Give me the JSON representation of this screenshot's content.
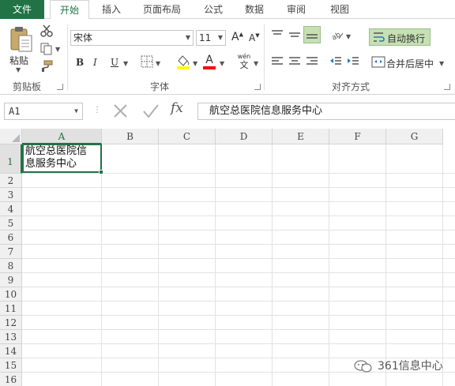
{
  "tabs": {
    "file": "文件",
    "home": "开始",
    "insert": "插入",
    "page_layout": "页面布局",
    "formulas": "公式",
    "data": "数据",
    "review": "审阅",
    "view": "视图"
  },
  "ribbon": {
    "clipboard": {
      "paste_label": "粘贴",
      "group_label": "剪贴板"
    },
    "font": {
      "font_name": "宋体",
      "font_size": "11",
      "bold": "B",
      "italic": "I",
      "underline": "U",
      "font_color_glyph": "A",
      "grow_font": "A",
      "shrink_font": "A",
      "phonetic_top": "wén",
      "phonetic_bottom": "文",
      "group_label": "字体"
    },
    "alignment": {
      "wrap_text": "自动换行",
      "merge_center": "合并后居中",
      "group_label": "对齐方式"
    }
  },
  "formula_bar": {
    "name_box": "A1",
    "fx": "fx",
    "content": "航空总医院信息服务中心"
  },
  "grid": {
    "columns": [
      "A",
      "B",
      "C",
      "D",
      "E",
      "F",
      "G"
    ],
    "rows": [
      "1",
      "2",
      "3",
      "4",
      "5",
      "6",
      "7",
      "8",
      "9",
      "10",
      "11",
      "12",
      "13",
      "14",
      "15",
      "16"
    ],
    "selected_cell": "A1",
    "cells": {
      "A1_line1": "航空总医院信",
      "A1_line2": "息服务中心"
    }
  },
  "watermark": "361信息中心",
  "colors": {
    "accent": "#217346",
    "highlight_fill": "#ffff00",
    "font_color": "#ff0000"
  }
}
